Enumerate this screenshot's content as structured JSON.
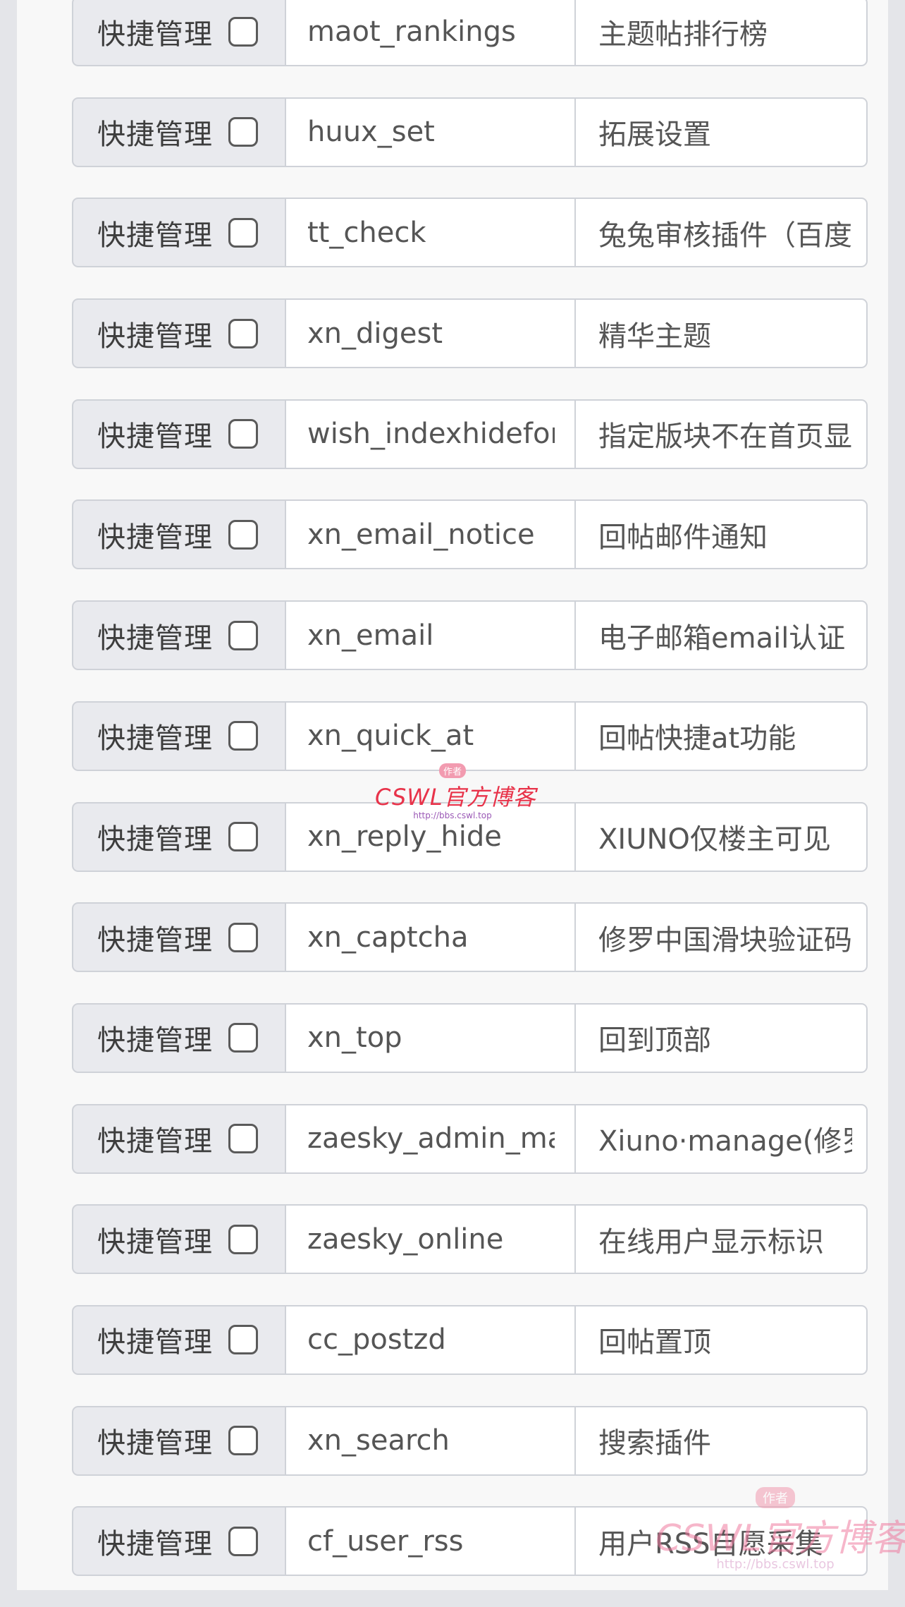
{
  "plugins": [
    {
      "label": "快捷管理",
      "key": "maot_rankings",
      "name": "主题帖排行榜",
      "checked": false
    },
    {
      "label": "快捷管理",
      "key": "huux_set",
      "name": "拓展设置",
      "checked": false
    },
    {
      "label": "快捷管理",
      "key": "tt_check",
      "name": "兔兔审核插件（百度",
      "checked": false
    },
    {
      "label": "快捷管理",
      "key": "xn_digest",
      "name": "精华主题",
      "checked": false
    },
    {
      "label": "快捷管理",
      "key": "wish_indexhideforum",
      "name": "指定版块不在首页显示",
      "checked": false
    },
    {
      "label": "快捷管理",
      "key": "xn_email_notice",
      "name": "回帖邮件通知",
      "checked": false
    },
    {
      "label": "快捷管理",
      "key": "xn_email",
      "name": "电子邮箱email认证",
      "checked": false
    },
    {
      "label": "快捷管理",
      "key": "xn_quick_at",
      "name": "回帖快捷at功能",
      "checked": false
    },
    {
      "label": "快捷管理",
      "key": "xn_reply_hide",
      "name": "XIUNO仅楼主可见",
      "checked": false
    },
    {
      "label": "快捷管理",
      "key": "xn_captcha",
      "name": "修罗中国滑块验证码",
      "checked": false
    },
    {
      "label": "快捷管理",
      "key": "xn_top",
      "name": "回到顶部",
      "checked": false
    },
    {
      "label": "快捷管理",
      "key": "zaesky_admin_manage",
      "name": "Xiuno·manage(修罗",
      "checked": false
    },
    {
      "label": "快捷管理",
      "key": "zaesky_online",
      "name": "在线用户显示标识",
      "checked": false
    },
    {
      "label": "快捷管理",
      "key": "cc_postzd",
      "name": "回帖置顶",
      "checked": false
    },
    {
      "label": "快捷管理",
      "key": "xn_search",
      "name": "搜索插件",
      "checked": false
    },
    {
      "label": "快捷管理",
      "key": "cf_user_rss",
      "name": "用户RSS自愿采集",
      "checked": false
    }
  ],
  "watermark": {
    "tag": "作者",
    "logo": "CSWL官方博客",
    "url": "http://bbs.cswl.top"
  },
  "colors": {
    "page_bg": "#e4e5e9",
    "panel_bg": "#f8f8f8",
    "label_bg": "#e9eaee",
    "border": "#cfd2d8",
    "watermark": "#e8334a"
  }
}
